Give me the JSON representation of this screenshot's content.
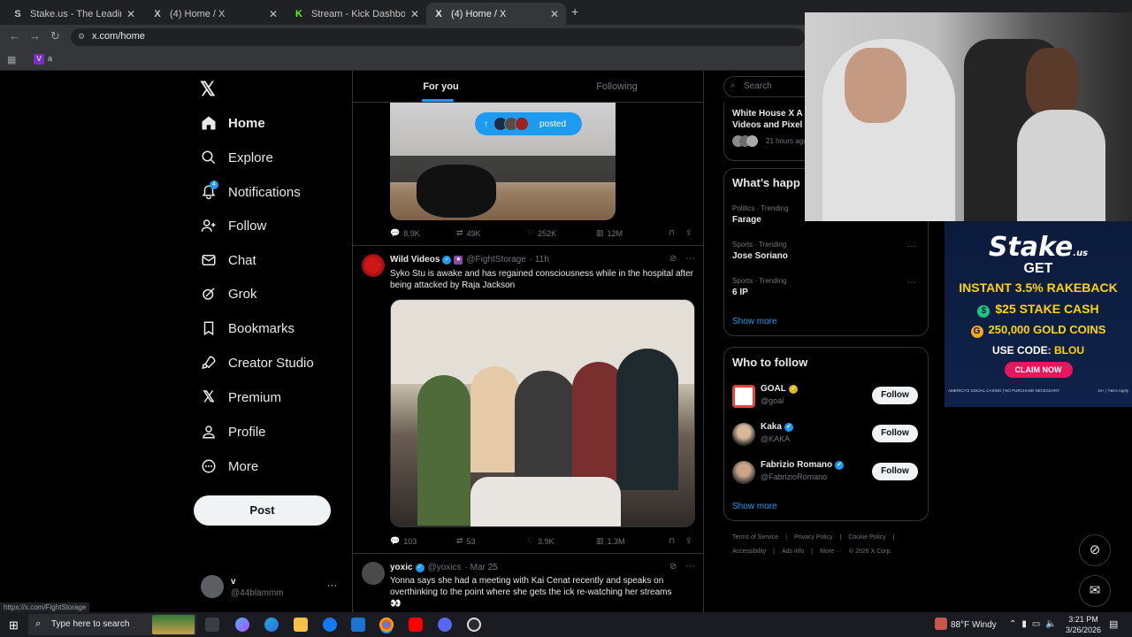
{
  "browser": {
    "tabs": [
      {
        "title": "Stake.us - The Leading Social C",
        "favicon": "S",
        "color": "#c4c7c5"
      },
      {
        "title": "(4) Home / X",
        "favicon": "X",
        "color": "#ffffff"
      },
      {
        "title": "Stream - Kick Dashboard",
        "favicon": "K",
        "color": "#53fc18"
      },
      {
        "title": "(4) Home / X",
        "favicon": "X",
        "color": "#ffffff"
      }
    ],
    "new_tab": "+",
    "url": "x.com/home",
    "bookmark_label": "a",
    "status_url": "https://x.com/FightStorage"
  },
  "nav": {
    "items": [
      {
        "label": "Home",
        "icon": "home-icon"
      },
      {
        "label": "Explore",
        "icon": "search-icon"
      },
      {
        "label": "Notifications",
        "icon": "bell-icon",
        "badge": "4"
      },
      {
        "label": "Follow",
        "icon": "add-person-icon"
      },
      {
        "label": "Chat",
        "icon": "mail-icon"
      },
      {
        "label": "Grok",
        "icon": "grok-icon"
      },
      {
        "label": "Bookmarks",
        "icon": "bookmark-icon"
      },
      {
        "label": "Creator Studio",
        "icon": "rocket-icon"
      },
      {
        "label": "Premium",
        "icon": "x-icon"
      },
      {
        "label": "Profile",
        "icon": "person-icon"
      },
      {
        "label": "More",
        "icon": "more-circle-icon"
      }
    ],
    "post": "Post",
    "account": {
      "name": "v",
      "handle": "@44blammm",
      "more": "···"
    }
  },
  "feed": {
    "tabs": [
      "For you",
      "Following"
    ],
    "posted_pill": "posted",
    "tweet1_actions": {
      "replies": "8.9K",
      "reposts": "49K",
      "likes": "252K",
      "views": "12M"
    },
    "tweet2": {
      "name": "Wild Videos",
      "handle": "@FightStorage",
      "time": "· 11h",
      "text": "Syko Stu is awake and has regained consciousness while in the hospital after being attacked by Raja Jackson",
      "actions": {
        "replies": "103",
        "reposts": "53",
        "likes": "3.9K",
        "views": "1.3M"
      }
    },
    "tweet3": {
      "name": "yoxic",
      "handle": "@yoxics",
      "time": "· Mar 25",
      "text": "Yonna says she had a meeting with Kai Cenat recently and speaks on overthinking to the point where she gets the ick re-watching her streams",
      "emoji": "👀"
    }
  },
  "right": {
    "search_placeholder": "Search",
    "top_card": {
      "title_line1": "White House X A",
      "title_line2": "Videos and Pixel",
      "time": "21 hours ago"
    },
    "happening_title": "What’s happ",
    "trends": [
      {
        "meta": "Politics · Trending",
        "name": "Farage"
      },
      {
        "meta": "Sports · Trending",
        "name": "Jose Soriano"
      },
      {
        "meta": "Sports · Trending",
        "name": "6 IP"
      }
    ],
    "show_more": "Show more",
    "who_to_follow": "Who to follow",
    "follow_label": "Follow",
    "suggestions": [
      {
        "name": "GOAL",
        "handle": "@goal",
        "badge": "gold"
      },
      {
        "name": "Kaka",
        "handle": "@KAKA",
        "badge": "blue"
      },
      {
        "name": "Fabrizio Romano",
        "handle": "@FabrizioRomano",
        "badge": "blue"
      }
    ],
    "footer_line1": [
      "Terms of Service",
      "|",
      "Privacy Policy",
      "|",
      "Cookie Policy",
      "|"
    ],
    "footer_line2": [
      "Accessibility",
      "|",
      "Ads info",
      "|",
      "More ···",
      "© 2026 X Corp."
    ]
  },
  "ad": {
    "brand": "Stake",
    "brand_sub": ".us",
    "line1": "GET",
    "line2": "INSTANT 3.5% RAKEBACK",
    "line3": "$25 STAKE CASH",
    "line4": "250,000 GOLD COINS",
    "code_label": "USE CODE:",
    "code": "BLOU",
    "cta": "CLAIM NOW",
    "fine_print": "AMERICA'S SOCIAL CASINO | NO PURCHASE NECESSARY",
    "fine_right": "21+ | T&Cs Apply"
  },
  "taskbar": {
    "search": "Type here to search",
    "weather": "88°F  Windy",
    "time": "3:21 PM",
    "date": "3/26/2026"
  },
  "colors": {
    "accent": "#1d9bf0",
    "bg": "#000000",
    "border": "#2f3336",
    "muted": "#71767b"
  }
}
